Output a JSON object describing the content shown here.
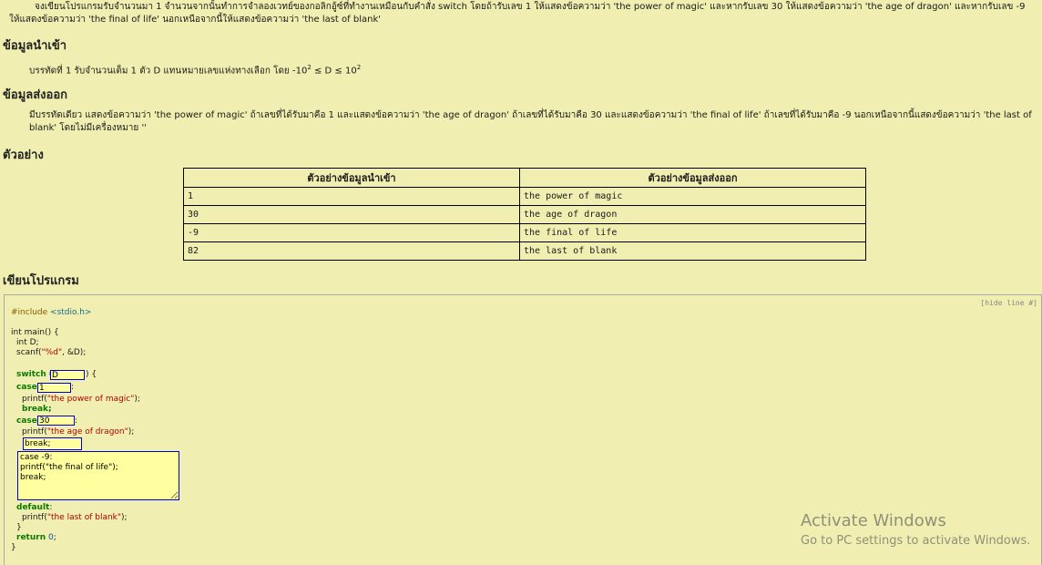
{
  "problem": {
    "intro": "จงเขียนโปรแกรมรับจำนวนมา 1 จำนวนจากนั้นทำการจำลองเวทย์ของกอลิกอู้ซ์ที่ทำงานเหมือนกับคำสั่ง switch โดยถ้ารับเลข 1 ให้แสดงข้อความว่า 'the power of magic' และหากรับเลข 30 ให้แสดงข้อความว่า 'the age of dragon' และหากรับเลข -9 ให้แสดงข้อความว่า 'the final of life' นอกเหนือจากนี้ให้แสดงข้อความว่า 'the last of blank'",
    "input_heading": "ข้อมูลนำเข้า",
    "input_text": "บรรทัดที่ 1 รับจำนวนเต็ม 1 ตัว D แทนหมายเลขแห่งทางเลือก โดย -10",
    "input_sup1": "2",
    "input_mid": " ≤ D ≤ 10",
    "input_sup2": "2",
    "output_heading": "ข้อมูลส่งออก",
    "output_text": "มีบรรทัดเดียว แสดงข้อความว่า 'the power of magic' ถ้าเลขที่ได้รับมาคือ 1 และแสดงข้อความว่า 'the age of dragon' ถ้าเลขที่ได้รับมาคือ 30 และแสดงข้อความว่า 'the final of life' ถ้าเลขที่ได้รับมาคือ -9 นอกเหนือจากนี้แสดงข้อความว่า 'the last of blank' โดยไม่มีเครื่องหมาย ''",
    "example_heading": "ตัวอย่าง",
    "program_heading": "เขียนโปรแกรม"
  },
  "examples": {
    "col_input": "ตัวอย่างข้อมูลนำเข้า",
    "col_output": "ตัวอย่างข้อมูลส่งออก",
    "rows": [
      {
        "input": "1",
        "output": "the power of magic"
      },
      {
        "input": "30",
        "output": "the age of dragon"
      },
      {
        "input": "-9",
        "output": "the final of life"
      },
      {
        "input": "82",
        "output": "the last of blank"
      }
    ]
  },
  "editor": {
    "hide_line": "[hide line #]",
    "include": "#include",
    "header": "<stdio.h>",
    "main_sig": "int main() {",
    "decl": "int D;",
    "scanf_fn": "scanf(",
    "scanf_fmt": "\"%d\"",
    "scanf_rest": ", &D);",
    "switch_kw": "switch",
    "switch_open": "(",
    "switch_value": "D",
    "switch_close": ") {",
    "case_kw": "case",
    "case1_value": "1",
    "colon": ":",
    "printf_fn": "printf(",
    "str_power": "\"the power of magic\"",
    "str_dragon": "\"the age of dragon\"",
    "str_last": "\"the last of blank\"",
    "close_call": ");",
    "break_kw": "break;",
    "case2_value": "30",
    "break_blank_value": "break;",
    "textarea_value": "case -9:\nprintf(\"the final of life\");\nbreak;",
    "default_kw": "default",
    "close_brace": "}",
    "return_kw": "return",
    "return_val": "0",
    "semicolon": ";"
  },
  "watermark": {
    "line1": "Activate Windows",
    "line2": "Go to PC settings to activate Windows."
  }
}
